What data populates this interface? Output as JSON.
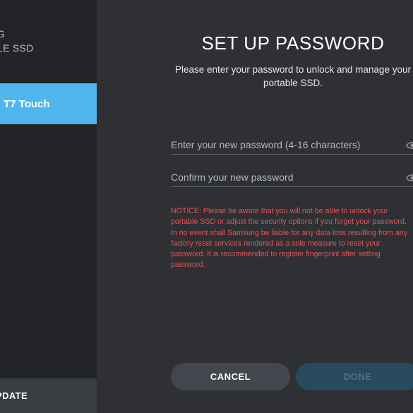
{
  "sidebar": {
    "brand_line1": "G",
    "brand_line2": "LE SSD",
    "device_label": "T7 Touch",
    "update_label": "PDATE"
  },
  "main": {
    "title": "SET UP PASSWORD",
    "subtitle": "Please enter your password to unlock and manage your portable SSD.",
    "new_password_placeholder": "Enter your new password (4-16 characters)",
    "confirm_password_placeholder": "Confirm your new password",
    "notice": "NOTICE: Please be aware that you will not be able to unlock your portable SSD or adjust the security options if you forget your password. In no event shall Samsung be liable for any data loss resulting from any factory reset services rendered as a sole measure to reset your password. It is recommended to register fingerprint after setting password.",
    "cancel_label": "CANCEL",
    "done_label": "DONE"
  },
  "icons": {
    "show_password": "eye-icon",
    "show_confirm": "eye-icon"
  },
  "colors": {
    "accent": "#4fb6ee",
    "notice": "#e0555a",
    "done_disabled": "#284a5e"
  }
}
